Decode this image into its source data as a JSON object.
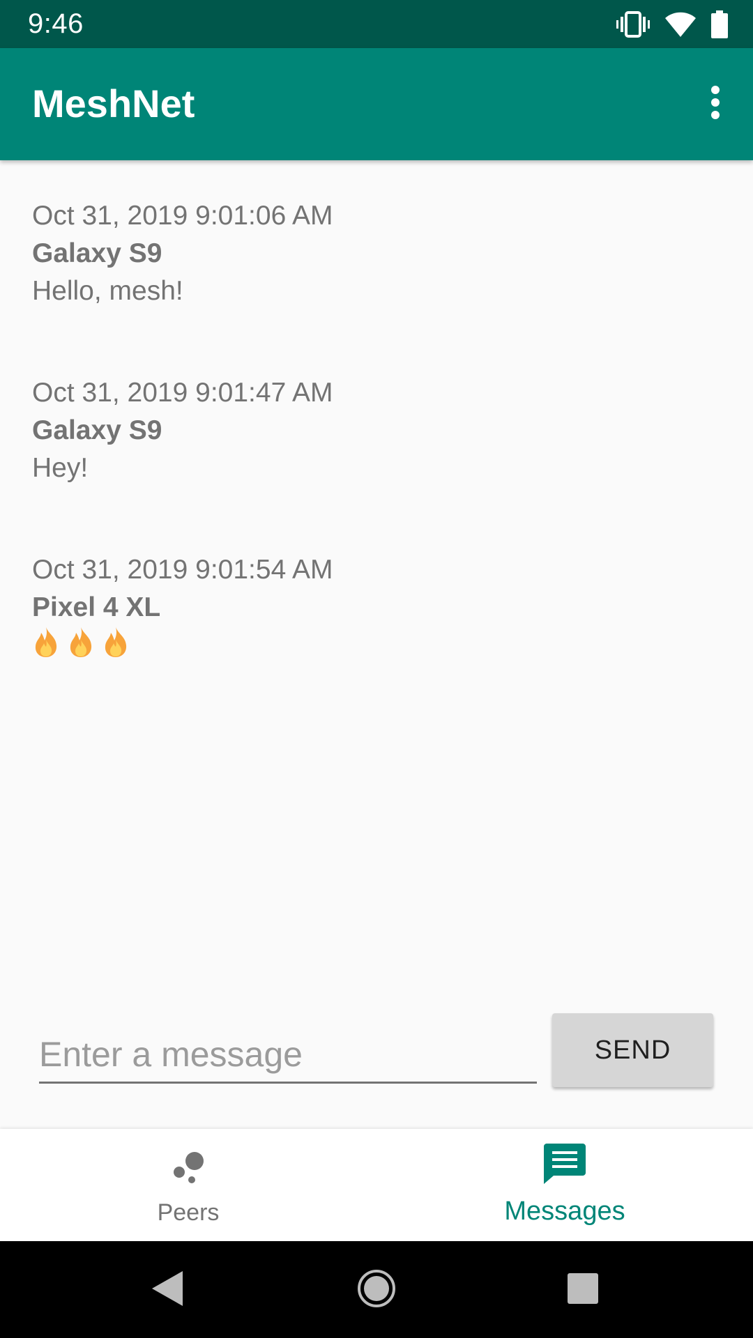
{
  "status_bar": {
    "time": "9:46",
    "icons": [
      "vibrate-icon",
      "wifi-icon",
      "battery-icon"
    ]
  },
  "app_bar": {
    "title": "MeshNet",
    "overflow_icon": "more-vert-icon"
  },
  "messages": [
    {
      "timestamp": "Oct 31, 2019 9:01:06 AM",
      "sender": "Galaxy S9",
      "text": "Hello, mesh!"
    },
    {
      "timestamp": "Oct 31, 2019 9:01:47 AM",
      "sender": "Galaxy S9",
      "text": "Hey!"
    },
    {
      "timestamp": "Oct 31, 2019 9:01:54 AM",
      "sender": "Pixel 4 XL",
      "text": "🔥🔥🔥"
    }
  ],
  "composer": {
    "input_value": "",
    "placeholder": "Enter a message",
    "send_label": "SEND"
  },
  "bottom_nav": {
    "tabs": [
      {
        "label": "Peers",
        "icon": "peers-icon",
        "selected": false
      },
      {
        "label": "Messages",
        "icon": "message-icon",
        "selected": true
      }
    ]
  },
  "colors": {
    "status_bar": "#00574b",
    "primary": "#008577",
    "background": "#fafafa",
    "text_secondary": "#737373"
  }
}
